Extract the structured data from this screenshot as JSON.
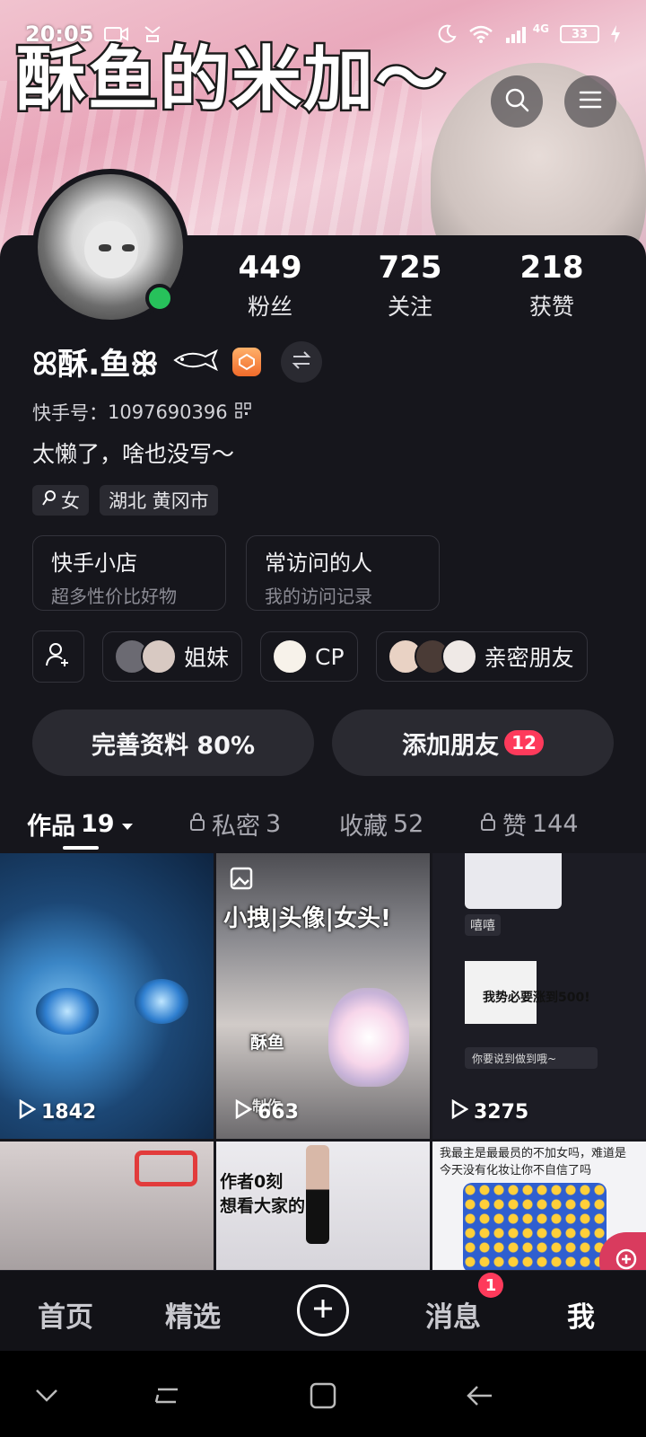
{
  "status_bar": {
    "time": "20:05",
    "network": "4G",
    "battery": "33"
  },
  "banner": {
    "title": "酥鱼的米加～"
  },
  "profile": {
    "stats": [
      {
        "value": "449",
        "label": "粉丝"
      },
      {
        "value": "725",
        "label": "关注"
      },
      {
        "value": "218",
        "label": "获赞"
      }
    ],
    "nickname": "ꕤ酥.鱼ꕥ",
    "kuaishou_id_label": "快手号：",
    "kuaishou_id": "1097690396",
    "bio": "太懒了，啥也没写～",
    "tags": [
      "女",
      "湖北 黄冈市"
    ]
  },
  "cards": [
    {
      "title": "快手小店",
      "subtitle": "超多性价比好物"
    },
    {
      "title": "常访问的人",
      "subtitle": "我的访问记录"
    }
  ],
  "friend_groups": [
    {
      "label": "姐妹"
    },
    {
      "label": "CP"
    },
    {
      "label": "亲密朋友"
    }
  ],
  "actions": {
    "complete_profile": "完善资料 80%",
    "add_friends": "添加朋友",
    "add_friends_badge": "12"
  },
  "tabs": [
    {
      "label": "作品",
      "count": "19"
    },
    {
      "label": "私密",
      "count": "3"
    },
    {
      "label": "收藏",
      "count": "52"
    },
    {
      "label": "赞",
      "count": "144"
    }
  ],
  "videos": [
    {
      "plays": "1842"
    },
    {
      "plays": "663",
      "overlay": "小拽|头像|女头!",
      "caption": "酥鱼",
      "caption2": "制作"
    },
    {
      "plays": "3275",
      "overlay": "我势必要涨到500!",
      "chat1": "嘻嘻",
      "chat2": "你要说到做到哦~"
    },
    {},
    {
      "overlay": "作者0刻\n想看大家的"
    },
    {
      "overlay": "我最主是最最员的不加女吗，难道是今天没有化妆让你不自信了吗"
    }
  ],
  "bottom_nav": {
    "items": [
      "首页",
      "精选",
      "消息",
      "我"
    ],
    "message_badge": "1"
  },
  "colors": {
    "accent_red": "#fe3a5b",
    "online_green": "#27c15b",
    "background": "#16161c"
  }
}
